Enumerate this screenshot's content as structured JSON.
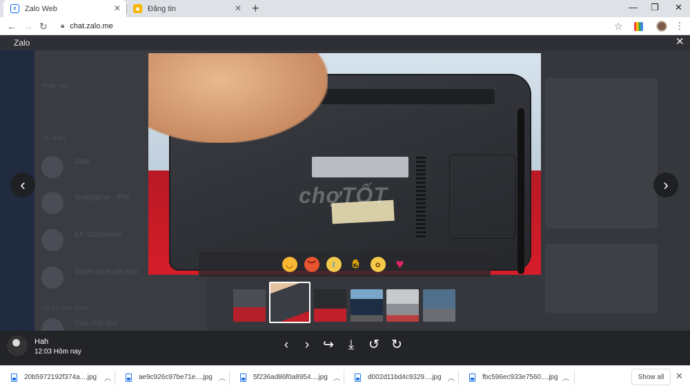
{
  "browser": {
    "tabs": [
      {
        "title": "Zalo Web",
        "favicon": "zalo-icon",
        "active": true
      },
      {
        "title": "Đăng tin",
        "favicon": "chotot-icon",
        "active": false
      }
    ],
    "new_tab_label": "+",
    "url": "chat.zalo.me"
  },
  "viewer": {
    "title": "Zalo",
    "watermark": "chợTỐT",
    "reactions": [
      "laugh-reaction",
      "angry-reaction",
      "cry-reaction",
      "like-reaction",
      "wow-reaction",
      "heart-reaction"
    ],
    "thumbnail_count": 6,
    "active_thumbnail": 2
  },
  "sender": {
    "name": "Hah",
    "time": "12:03 Hôm nay"
  },
  "background": {
    "sections": [
      "Nhắn mới",
      "Tin nhắn",
      "Có thể bạn quen"
    ],
    "contacts": [
      {
        "name": "Zalo"
      },
      {
        "name": "Gulogame - IPN"
      },
      {
        "name": "EK GodGame"
      },
      {
        "name": "Danh sách kết bạn"
      },
      {
        "name": "Chú chó nhỏ"
      }
    ]
  },
  "downloads": {
    "files": [
      "20b5972192f374a....jpg",
      "ae9c926c97be71e....jpg",
      "5f236ad86f0a8954....jpg",
      "d002d11bd4c9329....jpg",
      "fbc596ec933e7560....jpg"
    ],
    "show_all_label": "Show all"
  },
  "colors": {
    "overlay": "#2b2d33",
    "accent": "#1a73e8",
    "reaction_bar": "#28282c"
  }
}
